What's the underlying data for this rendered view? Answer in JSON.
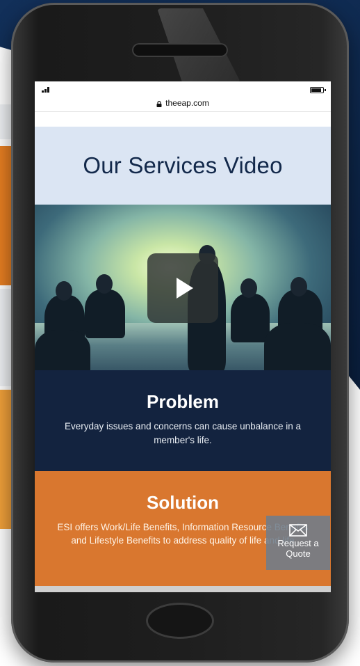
{
  "browser": {
    "url": "theeap.com"
  },
  "page": {
    "services_title": "Our Services Video",
    "problem": {
      "title": "Problem",
      "text": "Everyday issues and concerns can cause unbalance in a member's life."
    },
    "solution": {
      "title": "Solution",
      "text": "ESI offers Work/Life Benefits, Information Resource Benefits and Lifestyle Benefits to address quality of life and life"
    },
    "quote_button": {
      "line1": "Request a",
      "line2": "Quote"
    }
  },
  "colors": {
    "navy": "#13233f",
    "orange": "#d9772f",
    "light_blue": "#dbe5f3"
  },
  "icons": [
    "signal-icon",
    "battery-icon",
    "lock-icon",
    "play-icon",
    "mail-icon"
  ]
}
